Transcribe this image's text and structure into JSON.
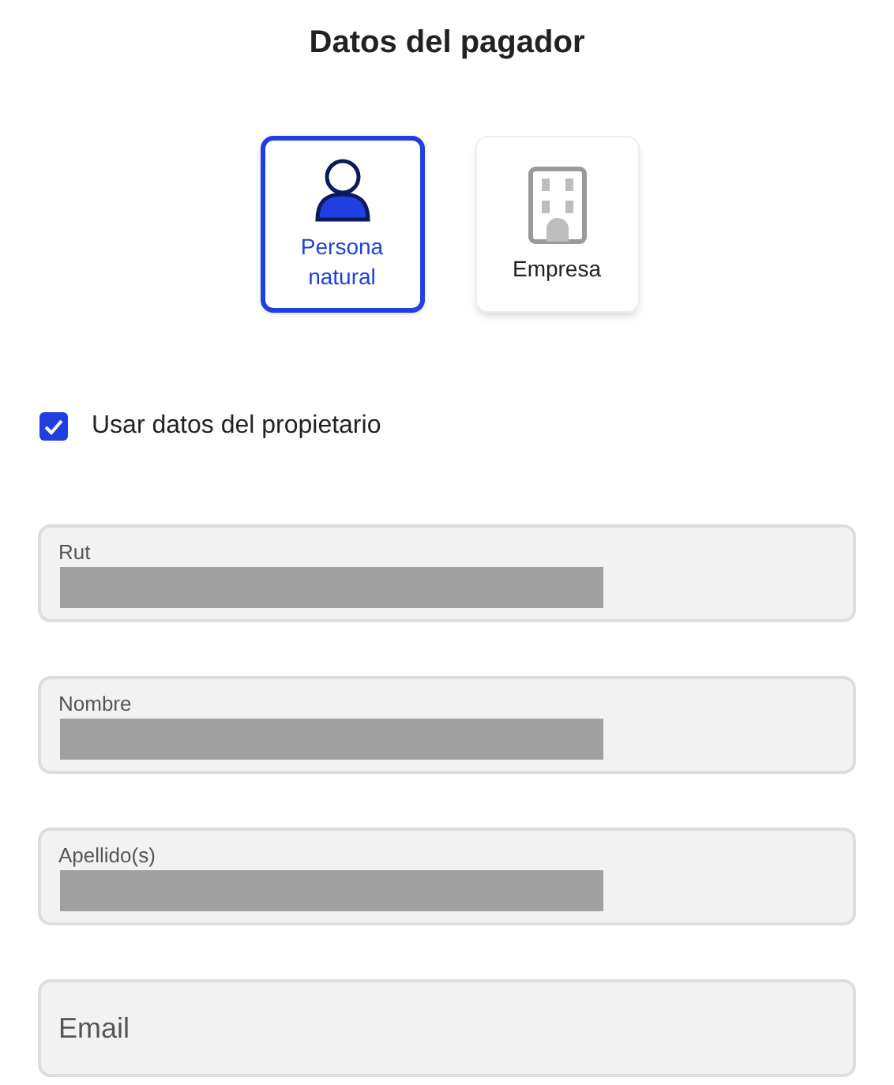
{
  "title": "Datos del pagador",
  "payer_types": [
    {
      "kind": "person",
      "label": "Persona natural",
      "selected": true
    },
    {
      "kind": "company",
      "label": "Empresa",
      "selected": false
    }
  ],
  "use_owner_data": {
    "label": "Usar datos del propietario",
    "checked": true
  },
  "fields": [
    {
      "label": "Rut",
      "redacted": true
    },
    {
      "label": "Nombre",
      "redacted": true
    },
    {
      "label": "Apellido(s)",
      "redacted": true
    },
    {
      "placeholder": "Email",
      "redacted": false
    }
  ]
}
